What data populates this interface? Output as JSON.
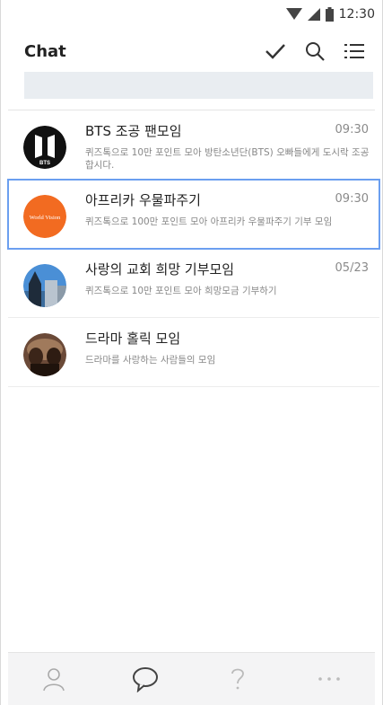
{
  "status": {
    "time": "12:30"
  },
  "header": {
    "title": "Chat"
  },
  "search": {
    "placeholder": ""
  },
  "chats": [
    {
      "name": "BTS 조공 팬모임",
      "date": "09:30",
      "desc": "퀴즈톡으로 10만 포인트 모아 방탄소년단(BTS) 오빠들에게 도시락 조공합시다."
    },
    {
      "name": "아프리카 우물파주기",
      "date": "09:30",
      "desc": "퀴즈톡으로 100만 포인트 모아 아프리카 우물파주기 기부 모임"
    },
    {
      "name": "사랑의 교회 희망 기부모임",
      "date": "05/23",
      "desc": "퀴즈톡으로 10만 포인트 모아 희망모금 기부하기"
    },
    {
      "name": "드라마 홀릭 모임",
      "date": "",
      "desc": "드라마를 사랑하는 사람들의 모임"
    }
  ],
  "logos": {
    "bts": "BTS",
    "world_vision": "World Vision"
  },
  "bottom_nav": [
    "person-icon",
    "chat-bubble-icon",
    "help-icon",
    "more-icon"
  ]
}
